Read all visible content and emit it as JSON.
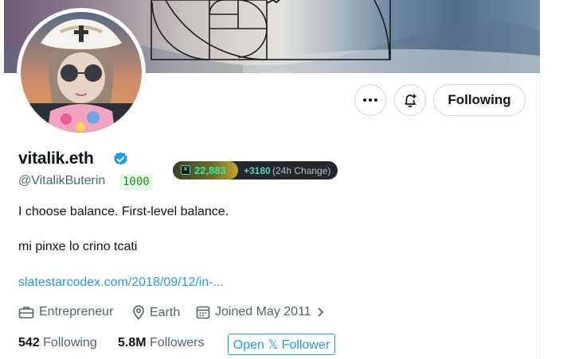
{
  "profile": {
    "display_name": "vitalik.eth",
    "handle": "@VitalikButerin",
    "score_badge": "1000",
    "verified_icon": "verified-badge-icon",
    "bio_line_1": "I choose balance. First-level balance.",
    "bio_line_2": "mi pinxe lo crino tcati",
    "link_text": "slatestarcodex.com/2018/09/12/in-..."
  },
  "actions": {
    "more_icon": "more-dots-icon",
    "notify_icon": "bell-plus-icon",
    "follow_label": "Following"
  },
  "extension_pill": {
    "count": "22,883",
    "delta": "+3180",
    "delta_note": "(24h Change)"
  },
  "meta": {
    "profession": "Entrepreneur",
    "location": "Earth",
    "joined": "Joined May 2011"
  },
  "stats": {
    "following_count": "542",
    "following_label": "Following",
    "followers_count": "5.8M",
    "followers_label": "Followers",
    "open_follower_label": "Open 𝕏 Follower"
  },
  "colors": {
    "accent_blue": "#1d9bf0",
    "text_primary": "#0f1419",
    "text_secondary": "#536471",
    "score_green": "#1a8f1a",
    "pill_bg": "#24272b"
  }
}
